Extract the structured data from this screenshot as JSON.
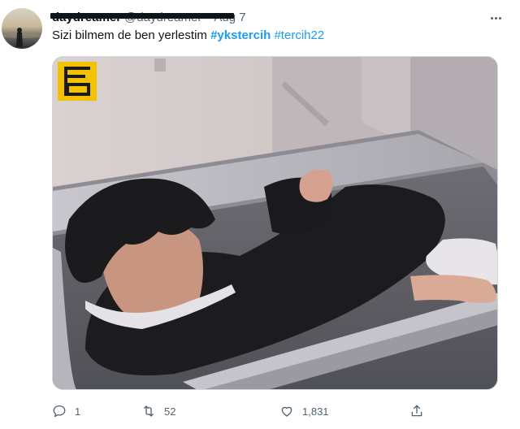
{
  "tweet": {
    "author": {
      "display_name": "daydreamer",
      "handle": "@daydreamer",
      "avatar_icon": "avatar-image"
    },
    "date": "Aug 7",
    "separator": "·",
    "text_plain": "Sizi bilmem de ben yerlestim ",
    "hashtags": [
      "#ykstercih",
      "#tercih22"
    ],
    "media_icon": "tweet-photo",
    "watermark_icon": "logo-watermark-icon",
    "stats": {
      "replies": "1",
      "retweets": "52",
      "likes": "1,831"
    },
    "icons": {
      "more": "more-icon",
      "reply": "reply-icon",
      "retweet": "retweet-icon",
      "like": "like-icon",
      "share": "share-icon"
    }
  },
  "colors": {
    "accent": "#1d9bf0",
    "text": "#0f1419",
    "muted": "#536471",
    "watermark": "#f2c200"
  }
}
